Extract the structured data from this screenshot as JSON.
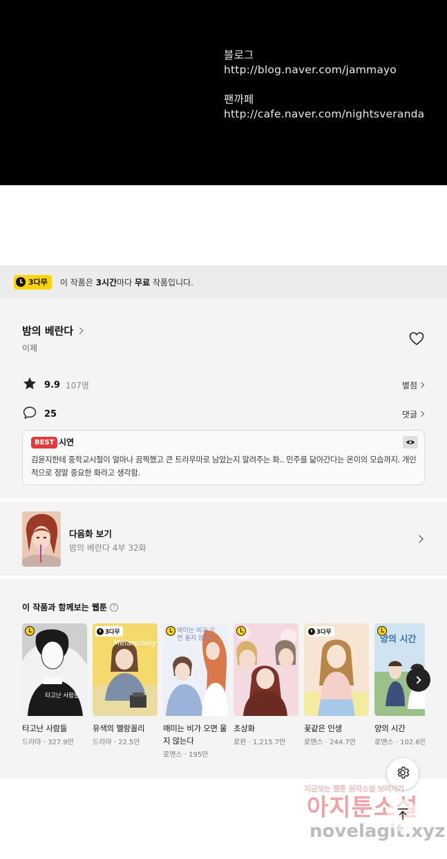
{
  "credits": {
    "blog_label": "블로그",
    "blog_url": "http://blog.naver.com/jammayo",
    "cafe_label": "팬까페",
    "cafe_url": "http://cafe.naver.com/nightsveranda"
  },
  "free_banner": {
    "badge": "3다무",
    "text_pre": "이 작품은 ",
    "text_hours": "3시간",
    "text_mid": "마다 ",
    "text_free": "무료",
    "text_post": " 작품입니다."
  },
  "series": {
    "title": "밤의 베란다",
    "author": "이제"
  },
  "rating": {
    "value": "9.9",
    "count": "107명",
    "link": "별점"
  },
  "comments": {
    "count": "25",
    "link": "댓글"
  },
  "best_comment": {
    "badge": "BEST",
    "user": "시연",
    "text": "김윤지한테 중학교시절이 얼마나 끔찍했고 큰 트라우마로 남았는지 알려주는 화.. 민주를 닮아간다는 온이의 모습까지. 개인적으로 정말 중요한 화라고 생각함."
  },
  "next_episode": {
    "title": "다음화 보기",
    "subtitle": "밤의 베란다 4부 32화"
  },
  "recommend": {
    "heading": "이 작품과 함께보는 웹툰",
    "help": "?",
    "items": [
      {
        "title": "타고난 사람들",
        "meta": "드라마 · 327.9만",
        "badge": "clock"
      },
      {
        "title": "유색의 멜랑꼴리",
        "meta": "드라마 · 22.5만",
        "badge": "3다무"
      },
      {
        "title": "매미는 비가 오면 울지 않는다",
        "meta": "로맨스 · 195만",
        "badge": "clock"
      },
      {
        "title": "초상화",
        "meta": "로판 · 1,215.7만",
        "badge": "clock"
      },
      {
        "title": "꽃같은 인생",
        "meta": "로맨스 · 244.7만",
        "badge": "3다무"
      },
      {
        "title": "양의 시간",
        "meta": "로맨스 · 102.6만",
        "badge": "clock"
      }
    ],
    "cover_texts": {
      "c1": "타고난 사람들",
      "c2": "Melancholy",
      "c3": "매미는 비가 오면 울지 않는다",
      "c6": "양의 시간"
    }
  },
  "watermark": {
    "line1": "지금보는 웹툰 원작소설 보러가기",
    "line2": "아지툰소설",
    "line3": "novelagit.xyz"
  },
  "colors": {
    "accent_yellow": "#ffd400",
    "best_red": "#e23b3b"
  }
}
